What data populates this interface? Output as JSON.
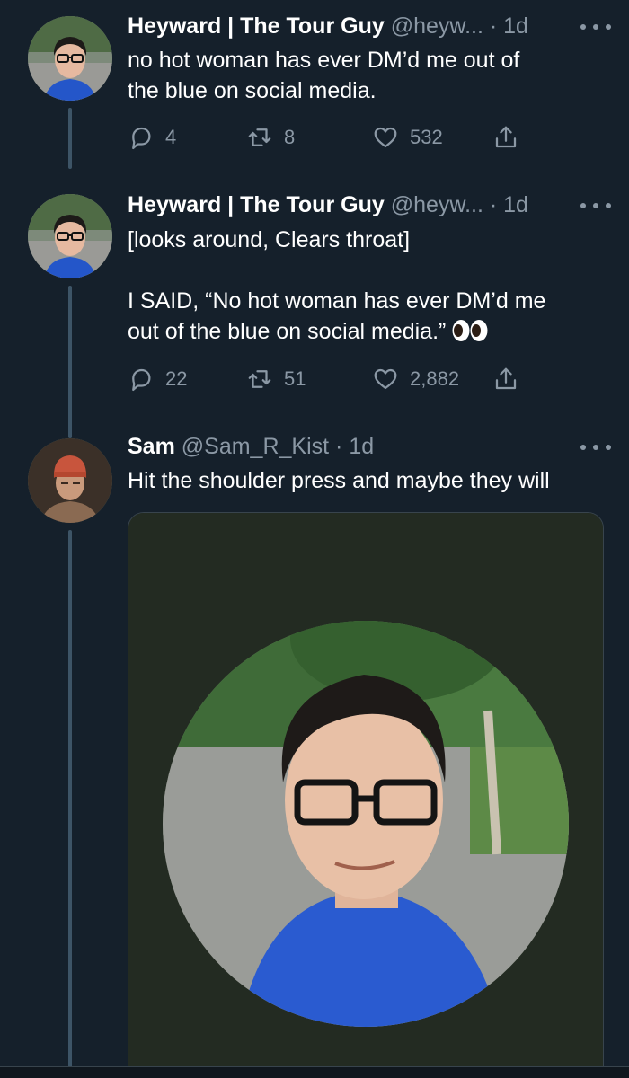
{
  "tweets": [
    {
      "name": "Heyward | The Tour Guy",
      "handle": "@heyw...",
      "dot": "·",
      "time": "1d",
      "text_lines": [
        "no hot woman has ever DM’d me out of",
        "the blue on social media."
      ],
      "replies": "4",
      "retweets": "8",
      "likes": "532"
    },
    {
      "name": "Heyward | The Tour Guy",
      "handle": "@heyw...",
      "dot": "·",
      "time": "1d",
      "text_lines": [
        "[looks around, Clears throat]",
        "",
        "I SAID, “No hot woman has ever DM’d me",
        "out of the blue on social media.”"
      ],
      "replies": "22",
      "retweets": "51",
      "likes": "2,882"
    },
    {
      "name": "Sam",
      "handle": "@Sam_R_Kist",
      "dot": "·",
      "time": "1d",
      "text_lines": [
        "Hit the shoulder press and maybe they will"
      ]
    }
  ],
  "icons": {
    "reply": "reply-icon",
    "retweet": "retweet-icon",
    "like": "heart-icon",
    "share": "share-icon",
    "more": "more-icon",
    "eyes": "eyes-emoji-icon"
  },
  "colors": {
    "background": "#15202b",
    "secondary_text": "#8b98a5",
    "thread_line": "#3d5466",
    "media_background": "#232b22"
  }
}
